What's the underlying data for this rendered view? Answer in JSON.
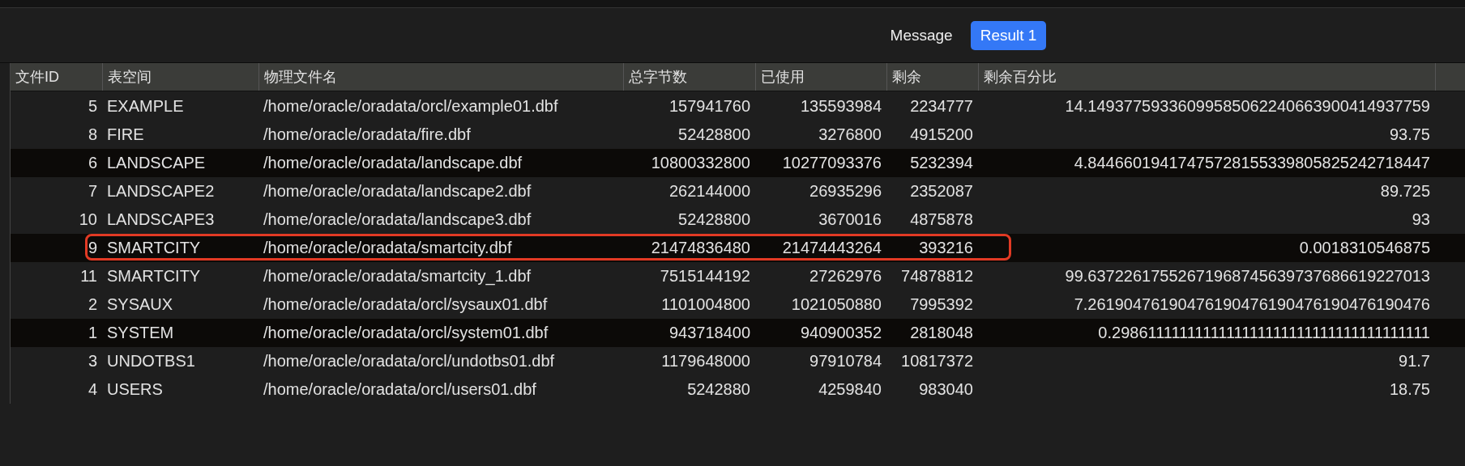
{
  "tabs": [
    {
      "label": "Message",
      "selected": false
    },
    {
      "label": "Result 1",
      "selected": true
    }
  ],
  "table": {
    "columns": [
      "文件ID",
      "表空间",
      "物理文件名",
      "总字节数",
      "已使用",
      "剩余",
      "剩余百分比"
    ],
    "rows": [
      {
        "cells": [
          "5",
          "EXAMPLE",
          "/home/oracle/oradata/orcl/example01.dbf",
          "157941760",
          "135593984",
          "2234777",
          "14.14937759336099585062240663900414937759"
        ],
        "selected": false,
        "marked": false
      },
      {
        "cells": [
          "8",
          "FIRE",
          "/home/oracle/oradata/fire.dbf",
          "52428800",
          "3276800",
          "4915200",
          "93.75"
        ],
        "selected": false,
        "marked": false
      },
      {
        "cells": [
          "6",
          "LANDSCAPE",
          "/home/oracle/oradata/landscape.dbf",
          "10800332800",
          "10277093376",
          "5232394",
          "4.84466019417475728155339805825242718447"
        ],
        "selected": true,
        "marked": false
      },
      {
        "cells": [
          "7",
          "LANDSCAPE2",
          "/home/oracle/oradata/landscape2.dbf",
          "262144000",
          "26935296",
          "2352087",
          "89.725"
        ],
        "selected": false,
        "marked": false
      },
      {
        "cells": [
          "10",
          "LANDSCAPE3",
          "/home/oracle/oradata/landscape3.dbf",
          "52428800",
          "3670016",
          "4875878",
          "93"
        ],
        "selected": false,
        "marked": false
      },
      {
        "cells": [
          "9",
          "SMARTCITY",
          "/home/oracle/oradata/smartcity.dbf",
          "21474836480",
          "21474443264",
          "393216",
          "0.0018310546875"
        ],
        "selected": true,
        "marked": true
      },
      {
        "cells": [
          "11",
          "SMARTCITY",
          "/home/oracle/oradata/smartcity_1.dbf",
          "7515144192",
          "27262976",
          "74878812",
          "99.63722617552671968745639737686619227013"
        ],
        "selected": false,
        "marked": false
      },
      {
        "cells": [
          "2",
          "SYSAUX",
          "/home/oracle/oradata/orcl/sysaux01.dbf",
          "1101004800",
          "1021050880",
          "7995392",
          "7.26190476190476190476190476190476190476"
        ],
        "selected": false,
        "marked": false
      },
      {
        "cells": [
          "1",
          "SYSTEM",
          "/home/oracle/oradata/orcl/system01.dbf",
          "943718400",
          "940900352",
          "2818048",
          "0.2986111111111111111111111111111111111111"
        ],
        "selected": true,
        "marked": false
      },
      {
        "cells": [
          "3",
          "UNDOTBS1",
          "/home/oracle/oradata/orcl/undotbs01.dbf",
          "1179648000",
          "97910784",
          "10817372",
          "91.7"
        ],
        "selected": false,
        "marked": false
      },
      {
        "cells": [
          "4",
          "USERS",
          "/home/oracle/oradata/orcl/users01.dbf",
          "5242880",
          "4259840",
          "983040",
          "18.75"
        ],
        "selected": false,
        "marked": false
      }
    ]
  }
}
